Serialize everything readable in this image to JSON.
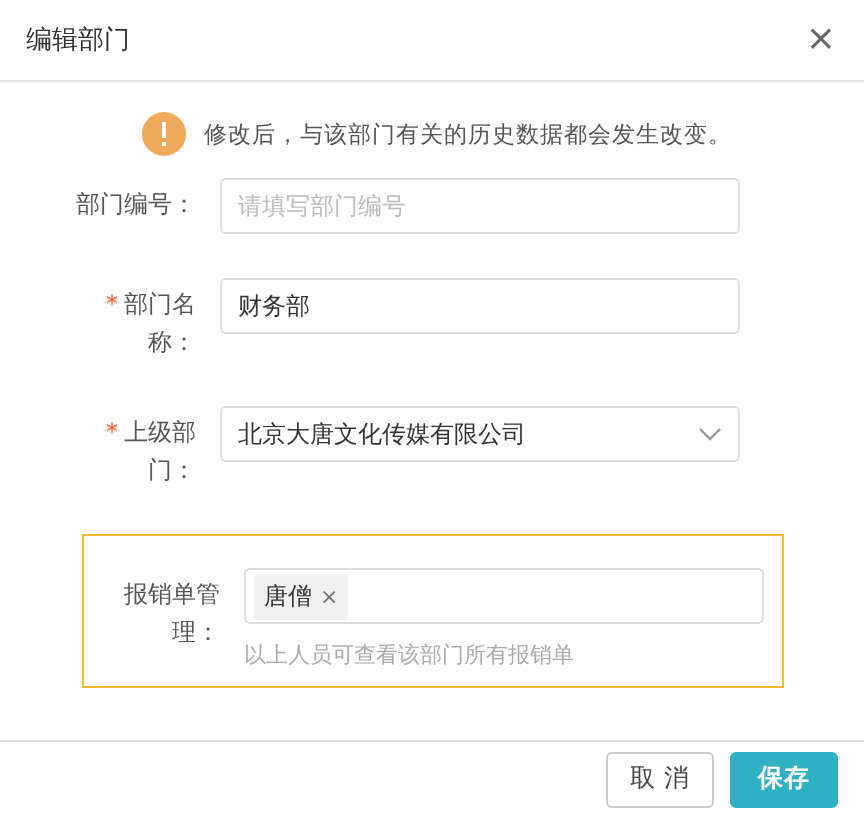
{
  "dialog": {
    "title": "编辑部门",
    "close": "×"
  },
  "notice": {
    "text": "修改后，与该部门有关的历史数据都会发生改变。"
  },
  "fields": [
    {
      "kind": "text",
      "label": "部门编号：",
      "highlighted": false,
      "placeholder": "请填写部门编号"
    },
    {
      "kind": "text",
      "label": "部门名称：",
      "required_mark": "*",
      "highlighted": false,
      "value": "财务部"
    },
    {
      "kind": "select",
      "label": "上级部门：",
      "required_mark": "*",
      "highlighted": false,
      "value": "北京大唐文化传媒有限公司"
    },
    {
      "kind": "tags",
      "label": "报销单管理：",
      "highlighted": true,
      "tags": [
        {
          "text": "唐僧",
          "remove": "×"
        }
      ],
      "hint": "以上人员可查看该部门所有报销单"
    }
  ],
  "buttons": [
    {
      "label": "取 消",
      "primary": false
    },
    {
      "label": "保存",
      "primary": true
    }
  ]
}
